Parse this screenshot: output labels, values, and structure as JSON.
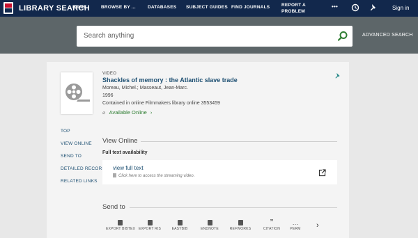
{
  "topbar": {
    "brand": "LIBRARY SEARCH",
    "nav": [
      "HOME",
      "BROWSE BY ...",
      "DATABASES",
      "SUBJECT GUIDES",
      "FIND JOURNALS"
    ],
    "report_line1": "REPORT A",
    "report_line2": "PROBLEM",
    "more": "•••",
    "signin": "Sign in"
  },
  "search": {
    "placeholder": "Search anything",
    "advanced": "ADVANCED SEARCH"
  },
  "record": {
    "type": "VIDEO",
    "title": "Shackles of memory : the Atlantic slave trade",
    "authors": "Moreau, Michel.; Masseaut, Jean-Marc.",
    "year": "1996",
    "source": "Contained in online Filmmakers library online 3553459",
    "availability": "Available Online"
  },
  "sidenav": [
    "TOP",
    "VIEW ONLINE",
    "SEND TO",
    "DETAILED RECORD",
    "RELATED LINKS"
  ],
  "view_online": {
    "heading": "View Online",
    "subheading": "Full text availability",
    "link": "view full text",
    "hint": "Click here to access the streaming video."
  },
  "send_to": {
    "heading": "Send to",
    "items": [
      "EXPORT BIBTEX",
      "EXPORT RIS",
      "EASYBIB",
      "ENDNOTE",
      "REFWORKS",
      "CITATION",
      "PERM"
    ],
    "next": "›"
  },
  "colors": {
    "nav_bg": "#12284c",
    "band_bg": "#5d6669",
    "link": "#1d4f72",
    "available": "#2e7d32",
    "accent_teal": "#2a8a8a"
  }
}
